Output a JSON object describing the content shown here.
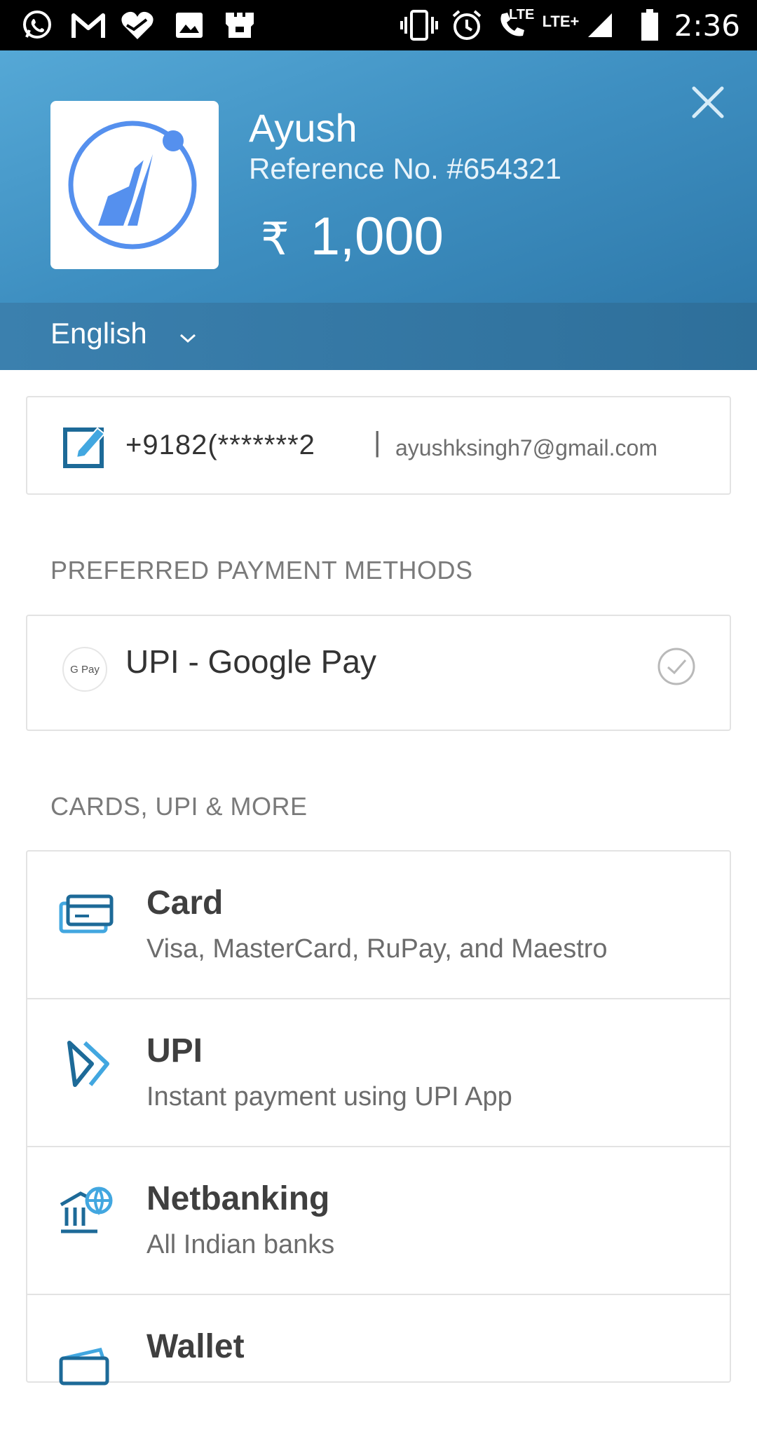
{
  "status_bar": {
    "time": "2:36",
    "icons": [
      "whatsapp-icon",
      "gmail-icon",
      "health-icon",
      "gallery-icon",
      "app-icon",
      "vibrate-icon",
      "alarm-icon",
      "volte-call-icon",
      "lte-signal-icon",
      "signal-icon",
      "battery-icon"
    ],
    "lte_label": "LTE",
    "lte_plus_label": "LTE+"
  },
  "header": {
    "merchant_name": "Ayush",
    "reference": "Reference No. #654321",
    "currency_symbol": "₹",
    "amount": "1,000",
    "language": "English"
  },
  "contact": {
    "phone": "+9182(*******2",
    "separator": "|",
    "email": "ayushksingh7@gmail.com"
  },
  "preferred": {
    "section_title": "PREFERRED PAYMENT METHODS",
    "gpay_badge": "G Pay",
    "method_label": "UPI - Google Pay"
  },
  "methods": {
    "section_title": "CARDS, UPI & MORE",
    "items": [
      {
        "title": "Card",
        "subtitle": "Visa, MasterCard, RuPay, and Maestro"
      },
      {
        "title": "UPI",
        "subtitle": "Instant payment using UPI App"
      },
      {
        "title": "Netbanking",
        "subtitle": "All Indian banks"
      },
      {
        "title": "Wallet",
        "subtitle": ""
      }
    ]
  },
  "colors": {
    "header_start": "#55a8d6",
    "header_end": "#2f7aab",
    "accent_blue": "#2f80c4",
    "icon_dark": "#1f6f9e"
  }
}
